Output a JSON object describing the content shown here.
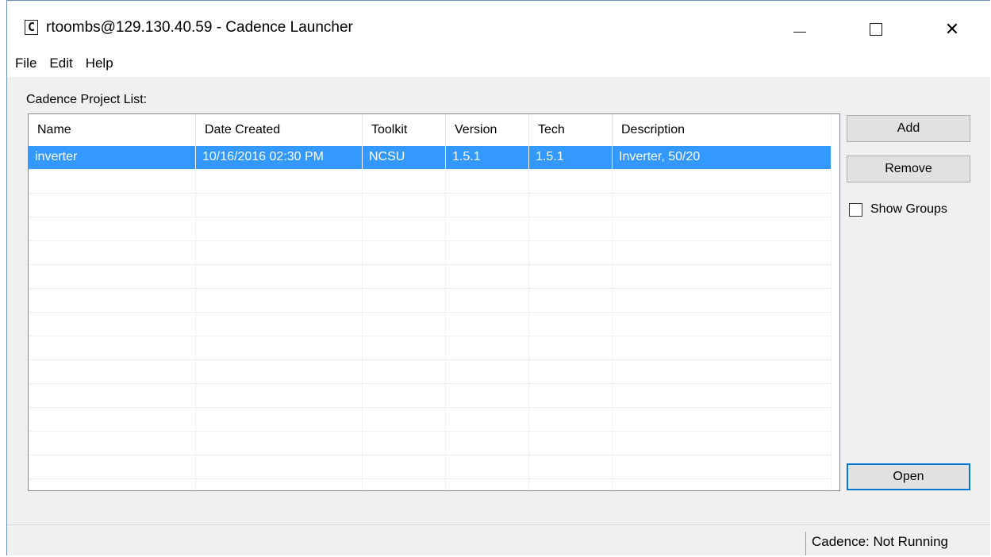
{
  "window": {
    "title": "rtoombs@129.130.40.59 - Cadence Launcher",
    "icon_glyph": "C",
    "controls": {
      "minimize": "minimize-icon",
      "maximize": "maximize-icon",
      "close_glyph": "✕"
    }
  },
  "menu": {
    "items": [
      "File",
      "Edit",
      "Help"
    ]
  },
  "project_list": {
    "label": "Cadence Project List:",
    "columns": [
      "Name",
      "Date Created",
      "Toolkit",
      "Version",
      "Tech",
      "Description"
    ],
    "rows": [
      [
        "inverter",
        "10/16/2016 02:30 PM",
        "NCSU",
        "1.5.1",
        "1.5.1",
        "Inverter, 50/20"
      ]
    ],
    "selected_row": 0
  },
  "buttons": {
    "add": "Add",
    "remove": "Remove",
    "open": "Open"
  },
  "show_groups": {
    "label": "Show Groups",
    "checked": false
  },
  "status": {
    "text": "Cadence: Not Running"
  },
  "colors": {
    "selection": "#3399ff",
    "focus_border": "#0078d7"
  }
}
